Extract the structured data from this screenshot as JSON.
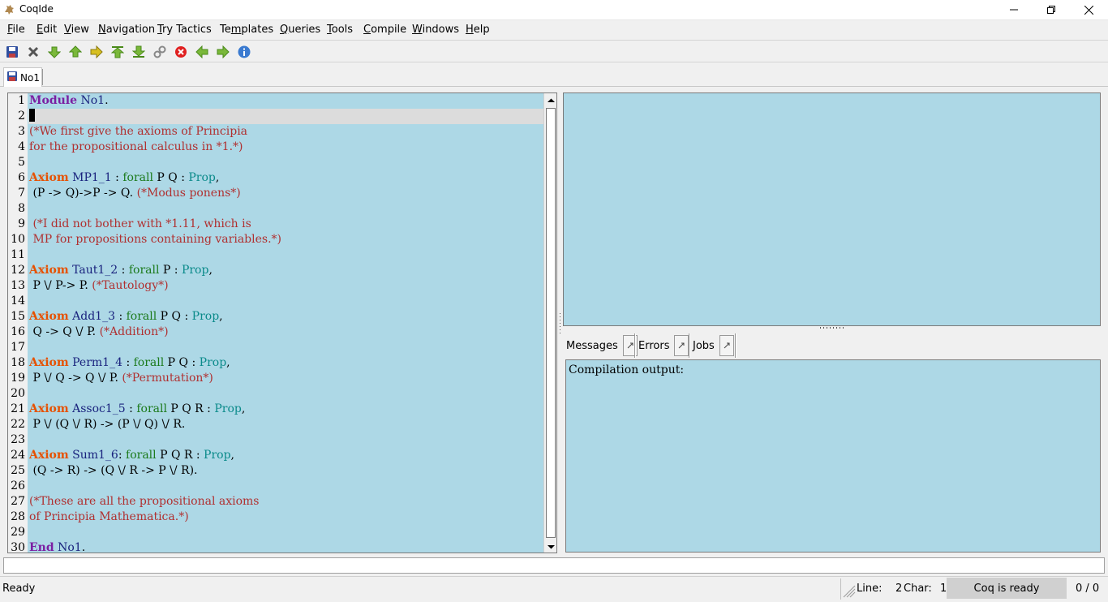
{
  "window": {
    "title": "CoqIde"
  },
  "menu": [
    {
      "pre": "",
      "ul": "F",
      "post": "ile"
    },
    {
      "pre": "",
      "ul": "E",
      "post": "dit"
    },
    {
      "pre": "",
      "ul": "V",
      "post": "iew"
    },
    {
      "pre": "",
      "ul": "N",
      "post": "avigation"
    },
    {
      "pre": "",
      "ul": "T",
      "post": "ry Tactics"
    },
    {
      "pre": "Te",
      "ul": "m",
      "post": "plates"
    },
    {
      "pre": "",
      "ul": "Q",
      "post": "ueries"
    },
    {
      "pre": "",
      "ul": "T",
      "post": "ools"
    },
    {
      "pre": "",
      "ul": "C",
      "post": "ompile"
    },
    {
      "pre": "",
      "ul": "W",
      "post": "indows"
    },
    {
      "pre": "",
      "ul": "H",
      "post": "elp"
    }
  ],
  "toolbar": {
    "icons": [
      "save-icon",
      "close-icon",
      "forward-one-icon",
      "backward-one-icon",
      "go-to-cursor-icon",
      "go-to-start-icon",
      "go-to-end-icon",
      "fully-check-icon",
      "interrupt-icon",
      "previous-occurrence-icon",
      "next-occurrence-icon",
      "about-icon"
    ]
  },
  "tab": {
    "label": "No1"
  },
  "editor": {
    "lines": [
      {
        "n": "1",
        "parts": [
          [
            "kw-mod",
            "Module"
          ],
          [
            "ident",
            " No1"
          ],
          [
            "txt",
            "."
          ]
        ]
      },
      {
        "n": "2",
        "parts": [],
        "cursor": true
      },
      {
        "n": "3",
        "parts": [
          [
            "cmt",
            "(*We first give the axioms of Principia"
          ]
        ]
      },
      {
        "n": "4",
        "parts": [
          [
            "cmt",
            "for the propositional calculus in *1.*)"
          ]
        ]
      },
      {
        "n": "5",
        "parts": []
      },
      {
        "n": "6",
        "parts": [
          [
            "kw-ax",
            "Axiom"
          ],
          [
            "ident",
            " MP1_1"
          ],
          [
            "txt",
            " : "
          ],
          [
            "tac",
            "forall"
          ],
          [
            "txt",
            " P Q : "
          ],
          [
            "typ",
            "Prop"
          ],
          [
            "txt",
            ","
          ]
        ]
      },
      {
        "n": "7",
        "parts": [
          [
            "txt",
            " (P -> Q)->P -> Q. "
          ],
          [
            "cmt",
            "(*Modus ponens*)"
          ]
        ]
      },
      {
        "n": "8",
        "parts": []
      },
      {
        "n": "9",
        "parts": [
          [
            "cmt",
            " (*I did not bother with *1.11, which is"
          ]
        ]
      },
      {
        "n": "10",
        "parts": [
          [
            "cmt",
            " MP for propositions containing variables.*)"
          ]
        ]
      },
      {
        "n": "11",
        "parts": []
      },
      {
        "n": "12",
        "parts": [
          [
            "kw-ax",
            "Axiom"
          ],
          [
            "ident",
            " Taut1_2"
          ],
          [
            "txt",
            " : "
          ],
          [
            "tac",
            "forall"
          ],
          [
            "txt",
            " P : "
          ],
          [
            "typ",
            "Prop"
          ],
          [
            "txt",
            ","
          ]
        ]
      },
      {
        "n": "13",
        "parts": [
          [
            "txt",
            " P \\/ P-> P. "
          ],
          [
            "cmt",
            "(*Tautology*)"
          ]
        ]
      },
      {
        "n": "14",
        "parts": []
      },
      {
        "n": "15",
        "parts": [
          [
            "kw-ax",
            "Axiom"
          ],
          [
            "ident",
            " Add1_3"
          ],
          [
            "txt",
            " : "
          ],
          [
            "tac",
            "forall"
          ],
          [
            "txt",
            " P Q : "
          ],
          [
            "typ",
            "Prop"
          ],
          [
            "txt",
            ","
          ]
        ]
      },
      {
        "n": "16",
        "parts": [
          [
            "txt",
            " Q -> Q \\/ P. "
          ],
          [
            "cmt",
            "(*Addition*)"
          ]
        ]
      },
      {
        "n": "17",
        "parts": []
      },
      {
        "n": "18",
        "parts": [
          [
            "kw-ax",
            "Axiom"
          ],
          [
            "ident",
            " Perm1_4"
          ],
          [
            "txt",
            " : "
          ],
          [
            "tac",
            "forall"
          ],
          [
            "txt",
            " P Q : "
          ],
          [
            "typ",
            "Prop"
          ],
          [
            "txt",
            ","
          ]
        ]
      },
      {
        "n": "19",
        "parts": [
          [
            "txt",
            " P \\/ Q -> Q \\/ P. "
          ],
          [
            "cmt",
            "(*Permutation*)"
          ]
        ]
      },
      {
        "n": "20",
        "parts": []
      },
      {
        "n": "21",
        "parts": [
          [
            "kw-ax",
            "Axiom"
          ],
          [
            "ident",
            " Assoc1_5"
          ],
          [
            "txt",
            " : "
          ],
          [
            "tac",
            "forall"
          ],
          [
            "txt",
            " P Q R : "
          ],
          [
            "typ",
            "Prop"
          ],
          [
            "txt",
            ","
          ]
        ]
      },
      {
        "n": "22",
        "parts": [
          [
            "txt",
            " P \\/ (Q \\/ R) -> (P \\/ Q) \\/ R."
          ]
        ]
      },
      {
        "n": "23",
        "parts": []
      },
      {
        "n": "24",
        "parts": [
          [
            "kw-ax",
            "Axiom"
          ],
          [
            "ident",
            " Sum1_6"
          ],
          [
            "txt",
            ": "
          ],
          [
            "tac",
            "forall"
          ],
          [
            "txt",
            " P Q R : "
          ],
          [
            "typ",
            "Prop"
          ],
          [
            "txt",
            ","
          ]
        ]
      },
      {
        "n": "25",
        "parts": [
          [
            "txt",
            " (Q -> R) -> (Q \\/ R -> P \\/ R)."
          ]
        ]
      },
      {
        "n": "26",
        "parts": []
      },
      {
        "n": "27",
        "parts": [
          [
            "cmt",
            "(*These are all the propositional axioms"
          ]
        ]
      },
      {
        "n": "28",
        "parts": [
          [
            "cmt",
            "of Principia Mathematica.*)"
          ]
        ]
      },
      {
        "n": "29",
        "parts": []
      },
      {
        "n": "30",
        "parts": [
          [
            "kw-mod",
            "End"
          ],
          [
            "ident",
            " No1"
          ],
          [
            "txt",
            "."
          ]
        ]
      }
    ]
  },
  "message_tabs": [
    {
      "label": "Messages"
    },
    {
      "label": "Errors"
    },
    {
      "label": "Jobs"
    }
  ],
  "messages": {
    "text": "Compilation output:"
  },
  "status": {
    "left": "Ready",
    "line_label": "Line:",
    "line_value": "2",
    "char_label": "Char:",
    "char_value": "1",
    "coq_status": "Coq is ready",
    "count": "0 / 0"
  },
  "colors": {
    "editor_bg": "#add8e6",
    "keyword_module": "#7b1fa2",
    "keyword_axiom": "#e65100",
    "comment": "#b03030",
    "tactic": "#1b7a1b",
    "type": "#0a8a8a"
  }
}
